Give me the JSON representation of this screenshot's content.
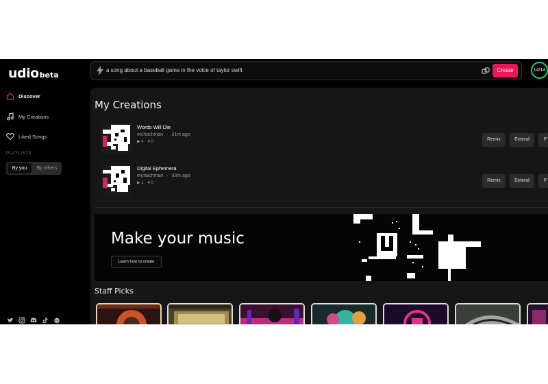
{
  "app": {
    "logo": "udio",
    "logo_badge": "beta"
  },
  "prompt": {
    "text": "a song about a baseball game in the voice of taylor swift",
    "create_label": "Create"
  },
  "credits": "14/14",
  "sidebar": {
    "items": [
      {
        "label": "Discover",
        "icon": "home-icon",
        "active": true
      },
      {
        "label": "My Creations",
        "icon": "music-note-icon",
        "active": false
      },
      {
        "label": "Liked Songs",
        "icon": "heart-icon",
        "active": false
      }
    ],
    "playlists_heading": "PLAYLISTS",
    "segment": [
      "By you",
      "By others"
    ],
    "socials": [
      "twitter-icon",
      "instagram-icon",
      "discord-icon",
      "tiktok-icon",
      "reddit-icon"
    ]
  },
  "my_creations": {
    "title": "My Creations",
    "songs": [
      {
        "title": "Words Will Die",
        "author": "mchachman",
        "sep": "·",
        "time": "31m ago",
        "plays": "4",
        "likes": "0"
      },
      {
        "title": "Digital Ephemera",
        "author": "mchachman",
        "sep": "·",
        "time": "33m ago",
        "plays": "1",
        "likes": "0"
      }
    ],
    "actions": [
      "Remix",
      "Extend",
      "P"
    ]
  },
  "banner": {
    "title": "Make your music",
    "button": "Learn how to create"
  },
  "staff_picks": {
    "title": "Staff Picks"
  },
  "colors": {
    "accent": "#e8185a",
    "credits_ring": "#1fce6a",
    "background": "#000000",
    "panel": "#161616"
  }
}
